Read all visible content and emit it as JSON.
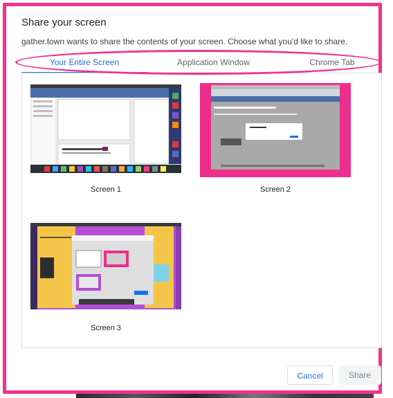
{
  "dialog": {
    "title": "Share your screen",
    "subtitle": "gather.town wants to share the contents of your screen. Choose what you'd like to share."
  },
  "tabs": [
    {
      "label": "Your Entire Screen",
      "active": true
    },
    {
      "label": "Application Window",
      "active": false
    },
    {
      "label": "Chrome Tab",
      "active": false
    }
  ],
  "screens": [
    {
      "label": "Screen 1"
    },
    {
      "label": "Screen 2"
    },
    {
      "label": "Screen 3"
    }
  ],
  "buttons": {
    "cancel": "Cancel",
    "share": "Share"
  },
  "colors": {
    "accent": "#1a73e8",
    "annotation": "#f0338f"
  }
}
